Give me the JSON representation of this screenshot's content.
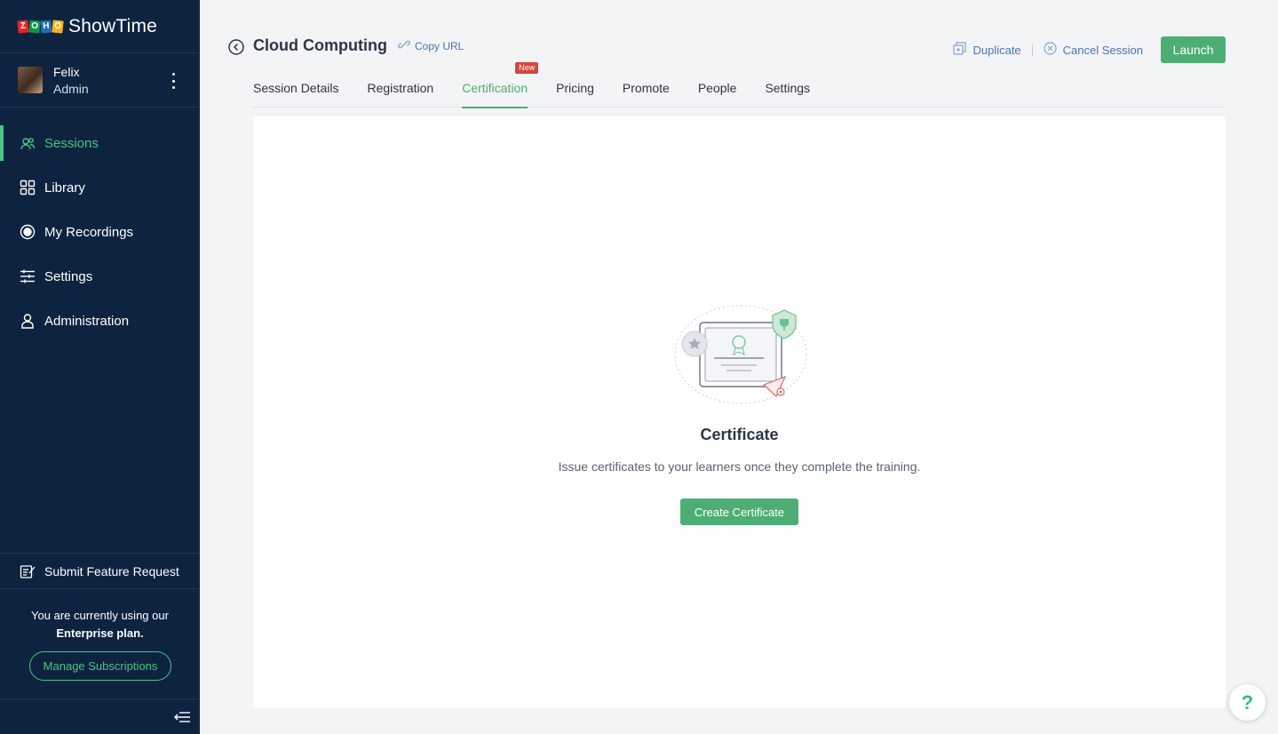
{
  "brand": {
    "logo_letters": [
      "Z",
      "O",
      "H",
      "O"
    ],
    "name": "ShowTime"
  },
  "user": {
    "name": "Felix",
    "role": "Admin"
  },
  "sidebar": {
    "items": [
      {
        "label": "Sessions",
        "icon": "sessions-icon",
        "active": true
      },
      {
        "label": "Library",
        "icon": "library-icon",
        "active": false
      },
      {
        "label": "My Recordings",
        "icon": "recordings-icon",
        "active": false
      },
      {
        "label": "Settings",
        "icon": "settings-sliders-icon",
        "active": false
      },
      {
        "label": "Administration",
        "icon": "administration-icon",
        "active": false
      }
    ],
    "feature_request": "Submit Feature Request",
    "plan_text": "You are currently using our",
    "plan_name": "Enterprise plan.",
    "manage_label": "Manage Subscriptions"
  },
  "header": {
    "title": "Cloud Computing",
    "copy_url": "Copy URL",
    "duplicate": "Duplicate",
    "cancel_session": "Cancel Session",
    "launch": "Launch"
  },
  "tabs": [
    {
      "label": "Session Details",
      "active": false
    },
    {
      "label": "Registration",
      "active": false
    },
    {
      "label": "Certification",
      "active": true,
      "badge": "New"
    },
    {
      "label": "Pricing",
      "active": false
    },
    {
      "label": "Promote",
      "active": false
    },
    {
      "label": "People",
      "active": false
    },
    {
      "label": "Settings",
      "active": false
    }
  ],
  "empty_state": {
    "title": "Certificate",
    "description": "Issue certificates to your learners once they complete the training.",
    "button": "Create Certificate"
  },
  "help": {
    "label": "?"
  },
  "colors": {
    "sidebar_bg": "#0e2340",
    "accent": "#4dae74",
    "link": "#4b73b3",
    "badge": "#d64540"
  }
}
